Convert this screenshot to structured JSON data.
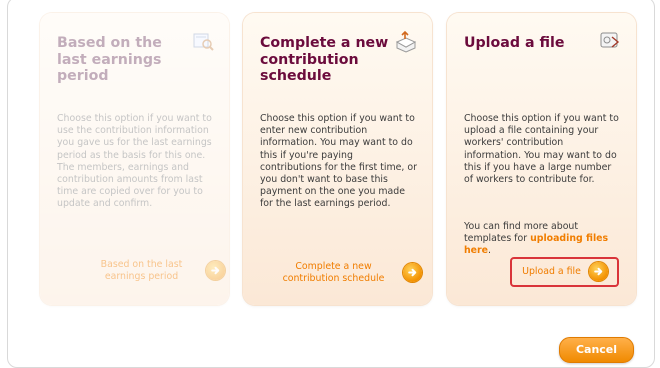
{
  "cards": [
    {
      "title": "Based on the last earnings period",
      "description": "Choose this option if you want to use the contribution information you gave us for the last earnings period as the basis for this one. The members, earnings and contribution amounts from last time are copied over for you to update and confirm.",
      "action_label": "Based on the last earnings period",
      "icon": "document-search-icon",
      "state": "disabled"
    },
    {
      "title": "Complete a new contribution schedule",
      "description": "Choose this option if you want to enter new contribution information. You may want to do this if you're paying contributions for the first time, or you don't want to base this payment on the one you made for the last earnings period.",
      "action_label": "Complete a new contribution schedule",
      "icon": "new-schedule-icon"
    },
    {
      "title": "Upload a file",
      "description": "Choose this option if you want to upload a file containing your workers' contribution information. You may want to do this if you have a large number of workers to contribute for.",
      "more_text": "You can find more about templates for ",
      "more_link": "uploading files here",
      "more_suffix": ".",
      "action_label": "Upload a file",
      "icon": "upload-file-icon"
    }
  ],
  "cancel_label": "Cancel",
  "colors": {
    "accent": "#f08a00",
    "title": "#6b0b3c",
    "highlight": "#d9343a"
  }
}
